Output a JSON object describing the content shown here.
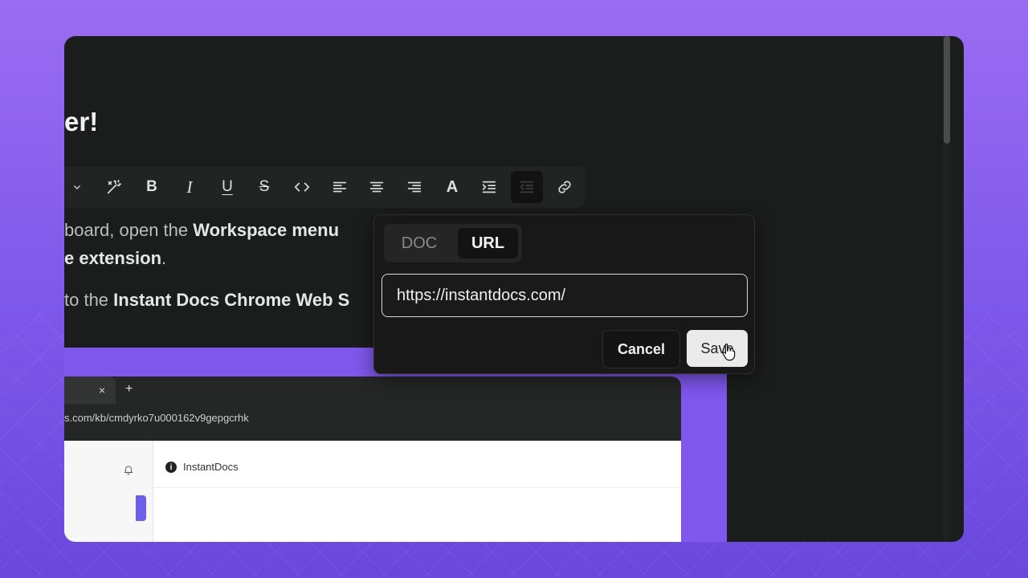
{
  "editor": {
    "heading": "er!",
    "paragraph_1": {
      "line_1_prefix": "board, open the ",
      "line_1_bold": "Workspace menu",
      "line_2_bold": "e extension",
      "line_2_suffix": "."
    },
    "paragraph_2": {
      "prefix": "to the ",
      "bold": "Instant Docs Chrome Web S"
    }
  },
  "toolbar": {
    "icons": [
      "chevron-down-icon",
      "magic-wand-icon",
      "bold-icon",
      "italic-icon",
      "underline-icon",
      "strikethrough-icon",
      "code-icon",
      "align-left-icon",
      "align-center-icon",
      "align-right-icon",
      "font-color-icon",
      "indent-icon",
      "outdent-icon",
      "link-icon"
    ],
    "bold_glyph": "B",
    "italic_glyph": "I",
    "underline_glyph": "U",
    "strike_glyph": "S",
    "font_glyph": "A",
    "active_tool": "outdent-icon"
  },
  "link_popover": {
    "tabs": [
      {
        "label": "DOC",
        "active": false
      },
      {
        "label": "URL",
        "active": true
      }
    ],
    "url_value": "https://instantdocs.com/",
    "cancel_label": "Cancel",
    "save_label": "Save"
  },
  "embedded_screenshot": {
    "tab_close": "×",
    "new_tab": "+",
    "address": "s.com/kb/cmdyrko7u000162v9gepgcrhk",
    "brand_icon": "i",
    "brand_name": "InstantDocs",
    "icons": [
      "bell-icon",
      "info-icon"
    ]
  },
  "colors": {
    "background_purple": "#8b5cf6",
    "editor_bg": "#1b1c1c",
    "popover_bg": "#181818",
    "accent": "#7f57ec"
  }
}
